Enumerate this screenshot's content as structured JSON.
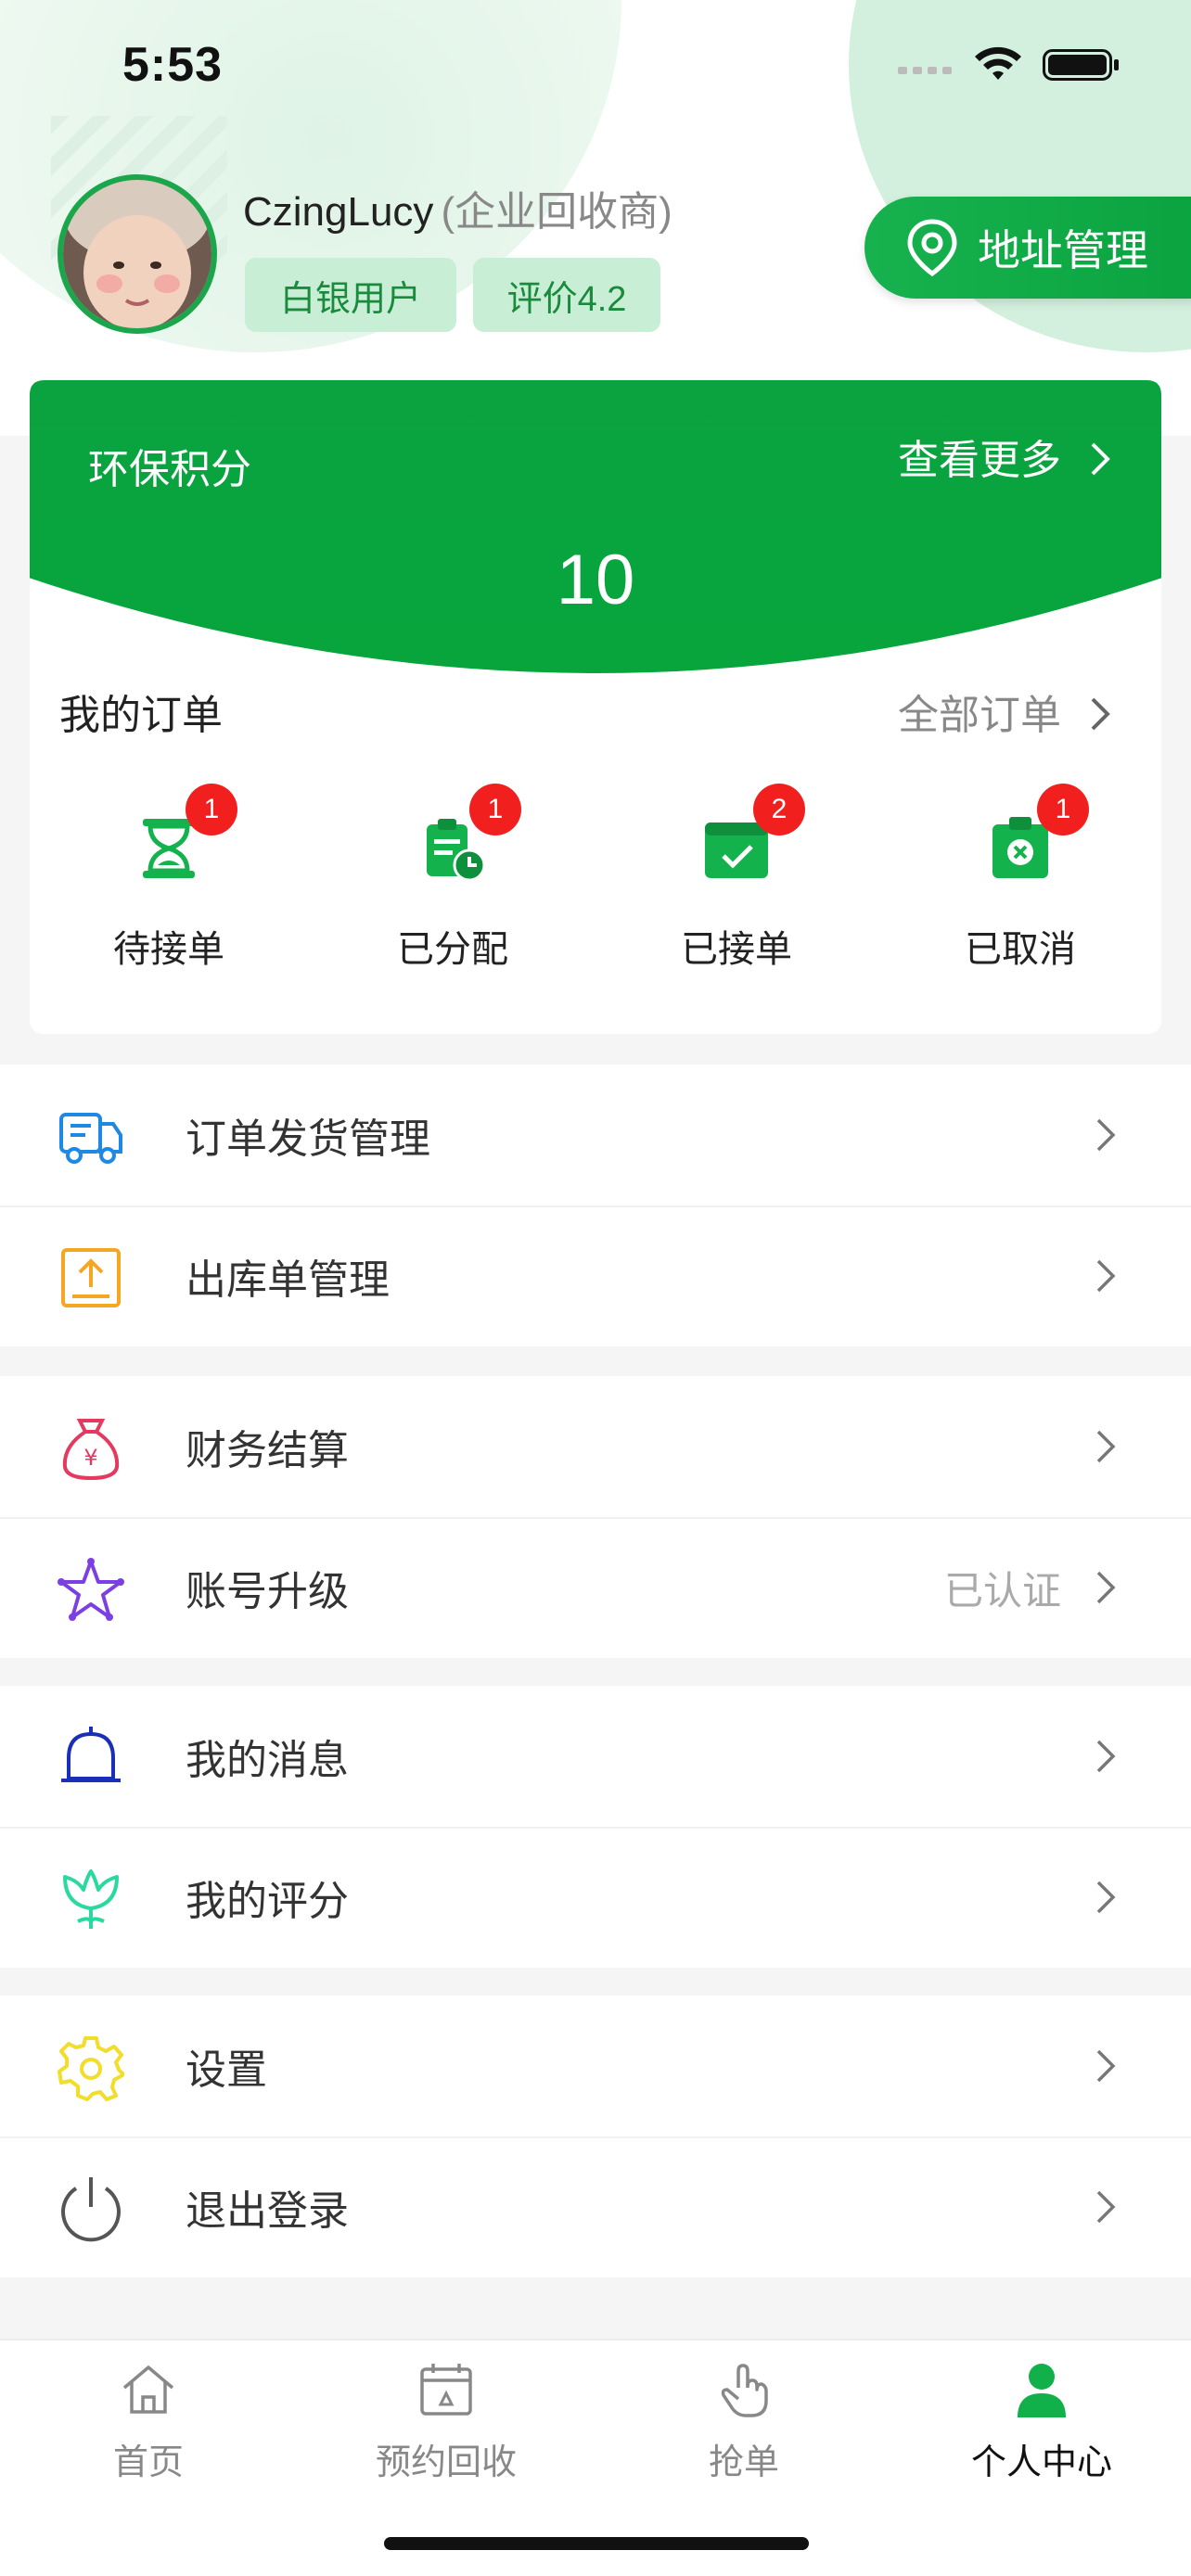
{
  "status_bar": {
    "time": "5:53"
  },
  "profile": {
    "username": "CzingLucy",
    "user_type": "(企业回收商)",
    "badges": [
      "白银用户",
      "评价4.2"
    ],
    "address_button": "地址管理"
  },
  "points": {
    "title": "环保积分",
    "more": "查看更多",
    "value": "10"
  },
  "orders": {
    "title": "我的订单",
    "all": "全部订单",
    "items": [
      {
        "label": "待接单",
        "count": "1",
        "icon": "hourglass-icon"
      },
      {
        "label": "已分配",
        "count": "1",
        "icon": "clipboard-clock-icon"
      },
      {
        "label": "已接单",
        "count": "2",
        "icon": "calendar-check-icon"
      },
      {
        "label": "已取消",
        "count": "1",
        "icon": "clipboard-cancel-icon"
      }
    ]
  },
  "menu": {
    "group1": [
      {
        "label": "订单发货管理",
        "icon": "truck-icon"
      },
      {
        "label": "出库单管理",
        "icon": "upload-box-icon"
      }
    ],
    "group2": [
      {
        "label": "财务结算",
        "icon": "money-bag-icon"
      },
      {
        "label": "账号升级",
        "icon": "star-icon",
        "extra": "已认证"
      }
    ],
    "group3": [
      {
        "label": "我的消息",
        "icon": "bell-icon"
      },
      {
        "label": "我的评分",
        "icon": "flower-icon"
      }
    ],
    "group4": [
      {
        "label": "设置",
        "icon": "gear-icon"
      },
      {
        "label": "退出登录",
        "icon": "power-icon"
      }
    ]
  },
  "tabbar": {
    "items": [
      {
        "label": "首页",
        "icon": "home-icon"
      },
      {
        "label": "预约回收",
        "icon": "calendar-recycle-icon"
      },
      {
        "label": "抢单",
        "icon": "hand-tap-icon"
      },
      {
        "label": "个人中心",
        "icon": "person-icon"
      }
    ],
    "active": "个人中心"
  },
  "colors": {
    "brand_green": "#0aa340",
    "badge_red": "#f21f1f",
    "badge_bg": "#c8efd6"
  }
}
